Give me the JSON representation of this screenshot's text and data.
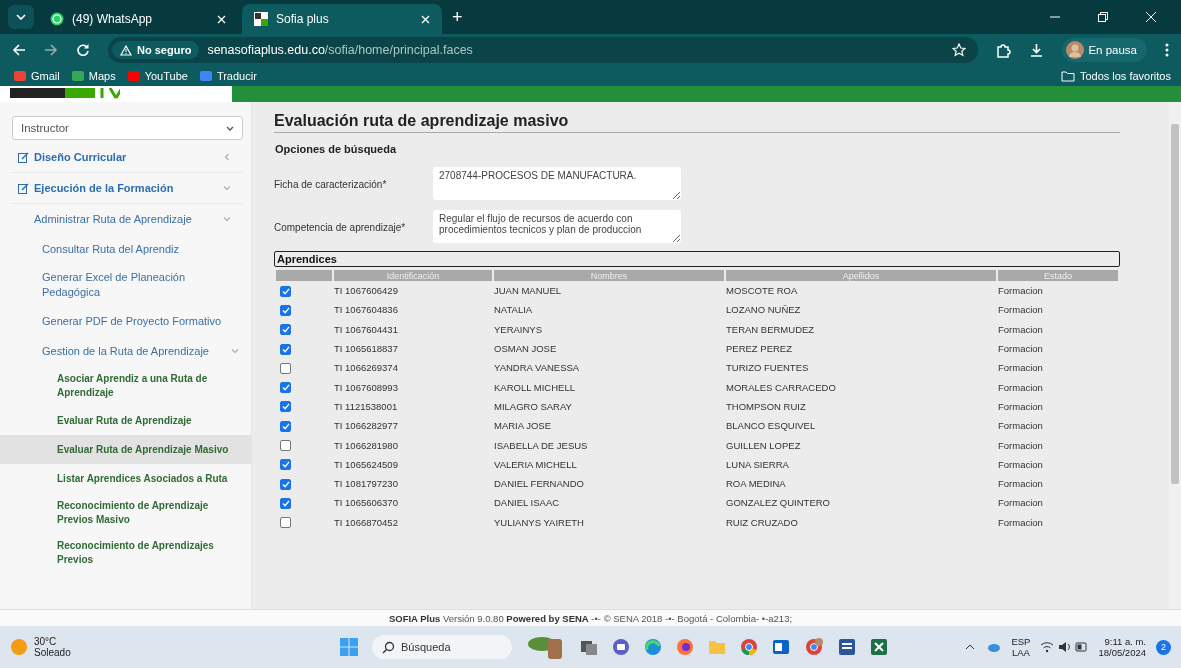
{
  "browser": {
    "tabs": [
      {
        "title": "(49) WhatsApp",
        "kind": "whatsapp",
        "selected": false
      },
      {
        "title": "Sofia plus",
        "kind": "sofia",
        "selected": true
      }
    ],
    "new_tab": "+",
    "security_label": "No seguro",
    "url_host": "senasofiaplus.edu.co",
    "url_path": "/sofia/home/principal.faces",
    "profile_status": "En pausa",
    "bookmarks": [
      {
        "label": "Gmail",
        "kind": "gmail"
      },
      {
        "label": "Maps",
        "kind": "maps"
      },
      {
        "label": "YouTube",
        "kind": "youtube"
      },
      {
        "label": "Traducir",
        "kind": "translate"
      }
    ],
    "all_bookmarks": "Todos los favoritos"
  },
  "sidebar": {
    "role_select": "Instructor",
    "items": [
      {
        "label": "Diseño Curricular",
        "expanded": false,
        "selected": false
      },
      {
        "label": "Ejecución de la Formación",
        "expanded": true,
        "selected": false,
        "children": [
          {
            "label": "Administrar Ruta de Aprendizaje",
            "expanded": true,
            "selected": false,
            "children": [
              {
                "label": "Consultar Ruta del Aprendiz",
                "selected": false
              },
              {
                "label": "Generar Excel de Planeación Pedagógica",
                "selected": false
              },
              {
                "label": "Generar PDF de Proyecto Formativo",
                "selected": false
              },
              {
                "label": "Gestion de la Ruta de Aprendizaje",
                "expanded": true,
                "selected": false,
                "children": [
                  {
                    "label": "Asociar Aprendiz a una Ruta de Aprendizaje",
                    "selected": false
                  },
                  {
                    "label": "Evaluar Ruta de Aprendizaje",
                    "selected": false
                  },
                  {
                    "label": "Evaluar Ruta de Aprendizaje Masivo",
                    "selected": true
                  },
                  {
                    "label": "Listar Aprendices Asociados a Ruta",
                    "selected": false
                  },
                  {
                    "label": "Reconocimiento de Aprendizaje Previos Masivo",
                    "selected": false
                  },
                  {
                    "label": "Reconocimiento de Aprendizajes Previos",
                    "selected": false
                  }
                ]
              }
            ]
          }
        ]
      }
    ]
  },
  "main": {
    "title": "Evaluación ruta de aprendizaje masivo",
    "section": "Opciones de búsqueda",
    "fields": [
      {
        "label": "Ficha de caracterización*",
        "value": "2708744-PROCESOS DE MANUFACTURA."
      },
      {
        "label": "Competencia de aprendizaje*",
        "value": "Regular el flujo de recursos de acuerdo con procedimientos tecnicos y plan de produccion"
      }
    ],
    "table_title": "Aprendices",
    "table": {
      "columns": [
        "Identificación",
        "Nombres",
        "Apellidos",
        "Estado"
      ],
      "rows": [
        {
          "checked": true,
          "cells": [
            "TI 1067606429",
            "JUAN MANUEL",
            "MOSCOTE ROA",
            "Formacion"
          ]
        },
        {
          "checked": true,
          "cells": [
            "TI 1067604836",
            "NATALIA",
            "LOZANO NUÑEZ",
            "Formacion"
          ]
        },
        {
          "checked": true,
          "cells": [
            "TI 1067604431",
            "YERAINYS",
            "TERAN BERMUDEZ",
            "Formacion"
          ]
        },
        {
          "checked": true,
          "cells": [
            "TI 1065618837",
            "OSMAN JOSE",
            "PEREZ PEREZ",
            "Formacion"
          ]
        },
        {
          "checked": false,
          "cells": [
            "TI 1066269374",
            "YANDRA VANESSA",
            "TURIZO FUENTES",
            "Formacion"
          ]
        },
        {
          "checked": true,
          "cells": [
            "TI 1067608993",
            "KAROLL MICHELL",
            "MORALES CARRACEDO",
            "Formacion"
          ]
        },
        {
          "checked": true,
          "cells": [
            "TI 1121538001",
            "MILAGRO SARAY",
            "THOMPSON RUIZ",
            "Formacion"
          ]
        },
        {
          "checked": true,
          "cells": [
            "TI 1066282977",
            "MARIA JOSE",
            "BLANCO ESQUIVEL",
            "Formacion"
          ]
        },
        {
          "checked": false,
          "cells": [
            "TI 1066281980",
            "ISABELLA DE JESUS",
            "GUILLEN LOPEZ",
            "Formacion"
          ]
        },
        {
          "checked": true,
          "cells": [
            "TI 1065624509",
            "VALERIA MICHELL",
            "LUNA SIERRA",
            "Formacion"
          ]
        },
        {
          "checked": true,
          "cells": [
            "TI 1081797230",
            "DANIEL FERNANDO",
            "ROA MEDINA",
            "Formacion"
          ]
        },
        {
          "checked": true,
          "cells": [
            "TI 1065606370",
            "DANIEL ISAAC",
            "GONZALEZ QUINTERO",
            "Formacion"
          ]
        },
        {
          "checked": false,
          "cells": [
            "TI 1066870452",
            "YULIANYS YAIRETH",
            "RUIZ CRUZADO",
            "Formacion"
          ]
        }
      ]
    }
  },
  "footer": "**SOFIA Plus** Versión 9.0.80 **Powered by SENA** -•- © SENA 2018 -•- Bogotá - Colombia- •-a213;",
  "taskbar": {
    "temperature": "30°C",
    "weather": "Soleado",
    "search_placeholder": "Búsqueda",
    "language": "ESP",
    "layout": "LAA",
    "time": "9:11 a. m.",
    "date": "18/05/2024",
    "notifications": "2"
  }
}
